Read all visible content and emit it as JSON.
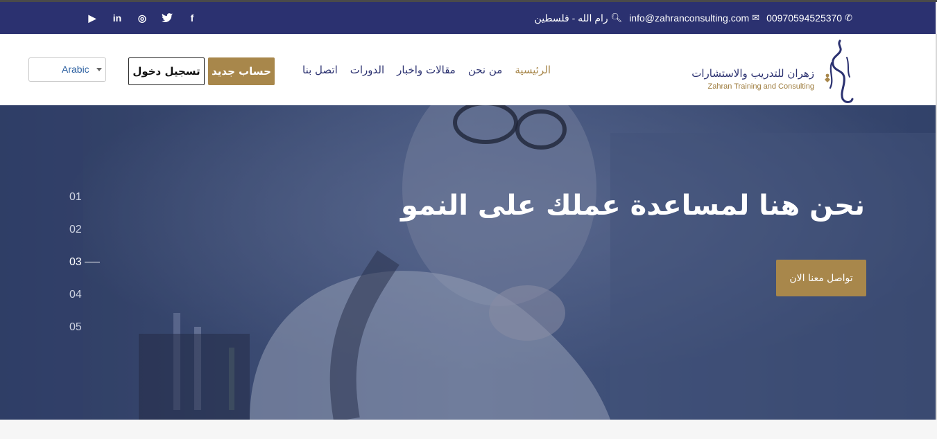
{
  "topbar": {
    "phone": "00970594525370",
    "phone_icon": "whatsapp-icon",
    "email": "info@zahranconsulting.com",
    "email_icon": "envelope-icon",
    "location": "رام الله - فلسطين",
    "location_icon": "search-location-icon",
    "social": [
      {
        "name": "facebook-icon",
        "glyph": "f"
      },
      {
        "name": "twitter-icon",
        "glyph": "t"
      },
      {
        "name": "instagram-icon",
        "glyph": "◎"
      },
      {
        "name": "linkedin-icon",
        "glyph": "in"
      },
      {
        "name": "youtube-icon",
        "glyph": "▶"
      }
    ]
  },
  "logo": {
    "arabic": "زهران للتدريب والاستشارات",
    "english": "Zahran Training and Consulting"
  },
  "nav": {
    "home": "الرئيسية",
    "about": "من نحن",
    "articles": "مقالات واخبار",
    "courses": "الدورات",
    "contact": "اتصل بنا"
  },
  "auth": {
    "register": "حساب جديد",
    "login": "تسجيل دخول"
  },
  "language": {
    "selected": "Arabic"
  },
  "hero": {
    "title": "نحن هنا لمساعدة عملك على النمو",
    "cta": "تواصل معنا الان",
    "slides": [
      "01",
      "02",
      "03",
      "04",
      "05"
    ],
    "active_slide": "03"
  },
  "colors": {
    "topbar_bg": "#2b3170",
    "accent_gold": "#a8874b",
    "nav_text": "#2b3170",
    "hero_overlay": "#3e4e74"
  }
}
